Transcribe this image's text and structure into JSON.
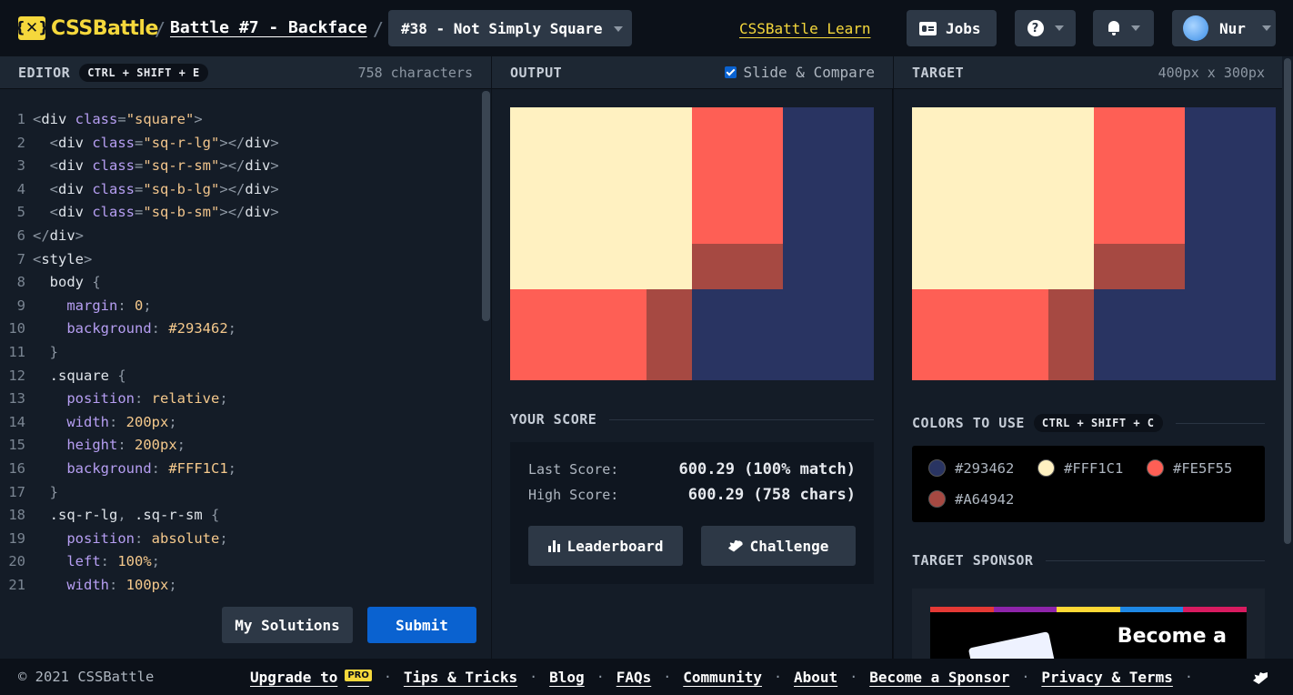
{
  "header": {
    "logo_mark": "{✕}",
    "logo_text": "CSSBattle",
    "separator": "/",
    "battle_link": "Battle #7 - Backface",
    "target_select": "#38 - Not Simply Square",
    "learn_link": "CSSBattle Learn",
    "jobs_label": "Jobs",
    "help_glyph": "?",
    "user_name": "Nur"
  },
  "editor": {
    "title": "EDITOR",
    "shortcut": "CTRL + SHIFT + E",
    "char_count": "758 characters",
    "lines": [
      {
        "n": "1",
        "tokens": [
          {
            "c": "t-p",
            "t": "<"
          },
          {
            "c": "txt",
            "t": "div "
          },
          {
            "c": "t-a",
            "t": "class"
          },
          {
            "c": "t-p",
            "t": "="
          },
          {
            "c": "t-s",
            "t": "\"square\""
          },
          {
            "c": "t-p",
            "t": ">"
          }
        ]
      },
      {
        "n": "2",
        "tokens": [
          {
            "c": "txt",
            "t": "  "
          },
          {
            "c": "t-p",
            "t": "<"
          },
          {
            "c": "txt",
            "t": "div "
          },
          {
            "c": "t-a",
            "t": "class"
          },
          {
            "c": "t-p",
            "t": "="
          },
          {
            "c": "t-s",
            "t": "\"sq-r-lg\""
          },
          {
            "c": "t-p",
            "t": "></"
          },
          {
            "c": "txt",
            "t": "div"
          },
          {
            "c": "t-p",
            "t": ">"
          }
        ]
      },
      {
        "n": "3",
        "tokens": [
          {
            "c": "txt",
            "t": "  "
          },
          {
            "c": "t-p",
            "t": "<"
          },
          {
            "c": "txt",
            "t": "div "
          },
          {
            "c": "t-a",
            "t": "class"
          },
          {
            "c": "t-p",
            "t": "="
          },
          {
            "c": "t-s",
            "t": "\"sq-r-sm\""
          },
          {
            "c": "t-p",
            "t": "></"
          },
          {
            "c": "txt",
            "t": "div"
          },
          {
            "c": "t-p",
            "t": ">"
          }
        ]
      },
      {
        "n": "4",
        "tokens": [
          {
            "c": "txt",
            "t": "  "
          },
          {
            "c": "t-p",
            "t": "<"
          },
          {
            "c": "txt",
            "t": "div "
          },
          {
            "c": "t-a",
            "t": "class"
          },
          {
            "c": "t-p",
            "t": "="
          },
          {
            "c": "t-s",
            "t": "\"sq-b-lg\""
          },
          {
            "c": "t-p",
            "t": "></"
          },
          {
            "c": "txt",
            "t": "div"
          },
          {
            "c": "t-p",
            "t": ">"
          }
        ]
      },
      {
        "n": "5",
        "tokens": [
          {
            "c": "txt",
            "t": "  "
          },
          {
            "c": "t-p",
            "t": "<"
          },
          {
            "c": "txt",
            "t": "div "
          },
          {
            "c": "t-a",
            "t": "class"
          },
          {
            "c": "t-p",
            "t": "="
          },
          {
            "c": "t-s",
            "t": "\"sq-b-sm\""
          },
          {
            "c": "t-p",
            "t": "></"
          },
          {
            "c": "txt",
            "t": "div"
          },
          {
            "c": "t-p",
            "t": ">"
          }
        ]
      },
      {
        "n": "6",
        "tokens": [
          {
            "c": "t-p",
            "t": "</"
          },
          {
            "c": "txt",
            "t": "div"
          },
          {
            "c": "t-p",
            "t": ">"
          }
        ]
      },
      {
        "n": "7",
        "tokens": [
          {
            "c": "t-p",
            "t": "<"
          },
          {
            "c": "txt",
            "t": "style"
          },
          {
            "c": "t-p",
            "t": ">"
          }
        ]
      },
      {
        "n": "8",
        "tokens": [
          {
            "c": "txt",
            "t": "  body "
          },
          {
            "c": "t-p",
            "t": "{"
          }
        ]
      },
      {
        "n": "9",
        "tokens": [
          {
            "c": "txt",
            "t": "    "
          },
          {
            "c": "t-a",
            "t": "margin"
          },
          {
            "c": "t-p",
            "t": ": "
          },
          {
            "c": "t-v",
            "t": "0"
          },
          {
            "c": "t-p",
            "t": ";"
          }
        ]
      },
      {
        "n": "10",
        "tokens": [
          {
            "c": "txt",
            "t": "    "
          },
          {
            "c": "t-a",
            "t": "background"
          },
          {
            "c": "t-p",
            "t": ": "
          },
          {
            "c": "t-v",
            "t": "#293462"
          },
          {
            "c": "t-p",
            "t": ";"
          }
        ]
      },
      {
        "n": "11",
        "tokens": [
          {
            "c": "txt",
            "t": "  "
          },
          {
            "c": "t-p",
            "t": "}"
          }
        ]
      },
      {
        "n": "12",
        "tokens": [
          {
            "c": "txt",
            "t": "  .square "
          },
          {
            "c": "t-p",
            "t": "{"
          }
        ]
      },
      {
        "n": "13",
        "tokens": [
          {
            "c": "txt",
            "t": "    "
          },
          {
            "c": "t-a",
            "t": "position"
          },
          {
            "c": "t-p",
            "t": ": "
          },
          {
            "c": "t-v",
            "t": "relative"
          },
          {
            "c": "t-p",
            "t": ";"
          }
        ]
      },
      {
        "n": "14",
        "tokens": [
          {
            "c": "txt",
            "t": "    "
          },
          {
            "c": "t-a",
            "t": "width"
          },
          {
            "c": "t-p",
            "t": ": "
          },
          {
            "c": "t-v",
            "t": "200px"
          },
          {
            "c": "t-p",
            "t": ";"
          }
        ]
      },
      {
        "n": "15",
        "tokens": [
          {
            "c": "txt",
            "t": "    "
          },
          {
            "c": "t-a",
            "t": "height"
          },
          {
            "c": "t-p",
            "t": ": "
          },
          {
            "c": "t-v",
            "t": "200px"
          },
          {
            "c": "t-p",
            "t": ";"
          }
        ]
      },
      {
        "n": "16",
        "tokens": [
          {
            "c": "txt",
            "t": "    "
          },
          {
            "c": "t-a",
            "t": "background"
          },
          {
            "c": "t-p",
            "t": ": "
          },
          {
            "c": "t-v",
            "t": "#FFF1C1"
          },
          {
            "c": "t-p",
            "t": ";"
          }
        ]
      },
      {
        "n": "17",
        "tokens": [
          {
            "c": "txt",
            "t": "  "
          },
          {
            "c": "t-p",
            "t": "}"
          }
        ]
      },
      {
        "n": "18",
        "tokens": [
          {
            "c": "txt",
            "t": "  .sq-r-lg"
          },
          {
            "c": "t-p",
            "t": ", "
          },
          {
            "c": "txt",
            "t": ".sq-r-sm "
          },
          {
            "c": "t-p",
            "t": "{"
          }
        ]
      },
      {
        "n": "19",
        "tokens": [
          {
            "c": "txt",
            "t": "    "
          },
          {
            "c": "t-a",
            "t": "position"
          },
          {
            "c": "t-p",
            "t": ": "
          },
          {
            "c": "t-v",
            "t": "absolute"
          },
          {
            "c": "t-p",
            "t": ";"
          }
        ]
      },
      {
        "n": "20",
        "tokens": [
          {
            "c": "txt",
            "t": "    "
          },
          {
            "c": "t-a",
            "t": "left"
          },
          {
            "c": "t-p",
            "t": ": "
          },
          {
            "c": "t-v",
            "t": "100%"
          },
          {
            "c": "t-p",
            "t": ";"
          }
        ]
      },
      {
        "n": "21",
        "tokens": [
          {
            "c": "txt",
            "t": "    "
          },
          {
            "c": "t-a",
            "t": "width"
          },
          {
            "c": "t-p",
            "t": ": "
          },
          {
            "c": "t-v",
            "t": "100px"
          },
          {
            "c": "t-p",
            "t": ";"
          }
        ]
      }
    ],
    "my_solutions_label": "My Solutions",
    "submit_label": "Submit"
  },
  "output": {
    "title": "OUTPUT",
    "slide_compare_label": "Slide & Compare",
    "slide_compare_checked": true,
    "score_title": "YOUR SCORE",
    "last_score_label": "Last Score:",
    "last_score_value": "600.29 (100% match)",
    "high_score_label": "High Score:",
    "high_score_value": "600.29 (758 chars)",
    "leaderboard_label": "Leaderboard",
    "challenge_label": "Challenge"
  },
  "target": {
    "title": "TARGET",
    "size": "400px x 300px",
    "colors_title": "COLORS TO USE",
    "colors_shortcut": "CTRL + SHIFT + C",
    "colors": [
      "#293462",
      "#FFF1C1",
      "#FE5F55",
      "#A64942"
    ],
    "sponsor_title": "TARGET SPONSOR",
    "sponsor_ad_text": "Become a"
  },
  "footer": {
    "copyright": "© 2021 CSSBattle",
    "upgrade_label": "Upgrade to",
    "pro_badge": "PRO",
    "separator": "·",
    "links": [
      "Tips & Tricks",
      "Blog",
      "FAQs",
      "Community",
      "About",
      "Become a Sponsor",
      "Privacy & Terms"
    ]
  },
  "theme": {
    "accent_yellow": "#f5d83c",
    "submit_blue": "#0a62d0",
    "panel_bg": "#141c27"
  }
}
